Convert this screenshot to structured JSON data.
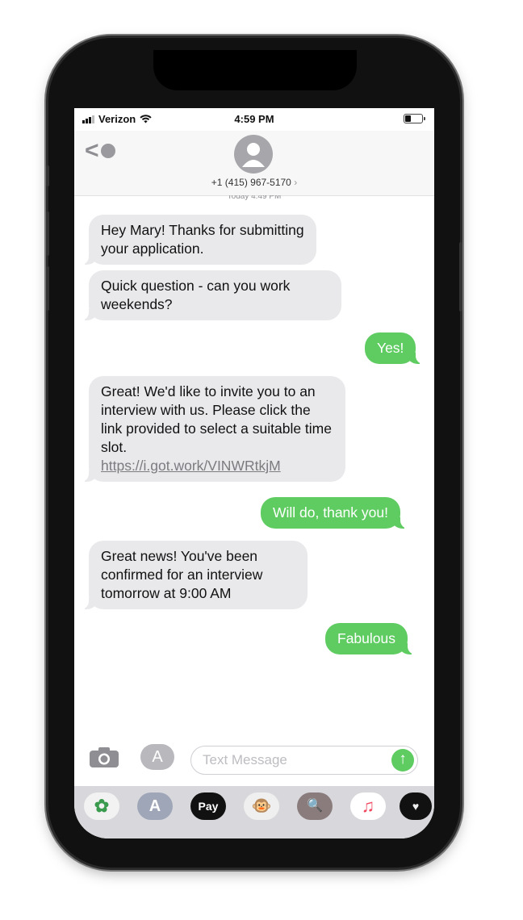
{
  "status_bar": {
    "carrier": "Verizon",
    "time": "4:59 PM"
  },
  "header": {
    "contact_number": "+1 (415) 967-5170",
    "contact_chevron": "›",
    "timestamp": "Today 4:49 PM",
    "back_chevron": "<"
  },
  "messages": [
    {
      "dir": "in",
      "text": "Hey Mary! Thanks for submitting your application."
    },
    {
      "dir": "in",
      "text": "Quick question - can you work weekends?"
    },
    {
      "dir": "out",
      "text": "Yes!"
    },
    {
      "dir": "in",
      "text": "Great! We'd like to invite you to an interview with us. Please click the link provided to select a suitable time slot.",
      "link": "https://i.got.work/VINWRtkjM"
    },
    {
      "dir": "out",
      "text": "Will do, thank you!"
    },
    {
      "dir": "in",
      "text": "Great news! You've been confirmed for an interview tomorrow at 9:00 AM"
    },
    {
      "dir": "out",
      "text": "Fabulous"
    }
  ],
  "composer": {
    "placeholder": "Text Message",
    "send_icon": "↑",
    "apps_icon": "A"
  },
  "app_drawer": [
    {
      "icon": "photos-icon",
      "label": "✿"
    },
    {
      "icon": "app-store-icon",
      "label": "A"
    },
    {
      "icon": "apple-pay-icon",
      "label": "Pay"
    },
    {
      "icon": "animoji-icon",
      "label": "🐵"
    },
    {
      "icon": "image-search-icon",
      "label": "🔍"
    },
    {
      "icon": "music-icon",
      "label": "♫"
    },
    {
      "icon": "digital-touch-icon",
      "label": "♥"
    }
  ],
  "colors": {
    "incoming_bubble": "#e9e9eb",
    "outgoing_bubble": "#5fcc62",
    "send_button": "#5fcc62"
  }
}
